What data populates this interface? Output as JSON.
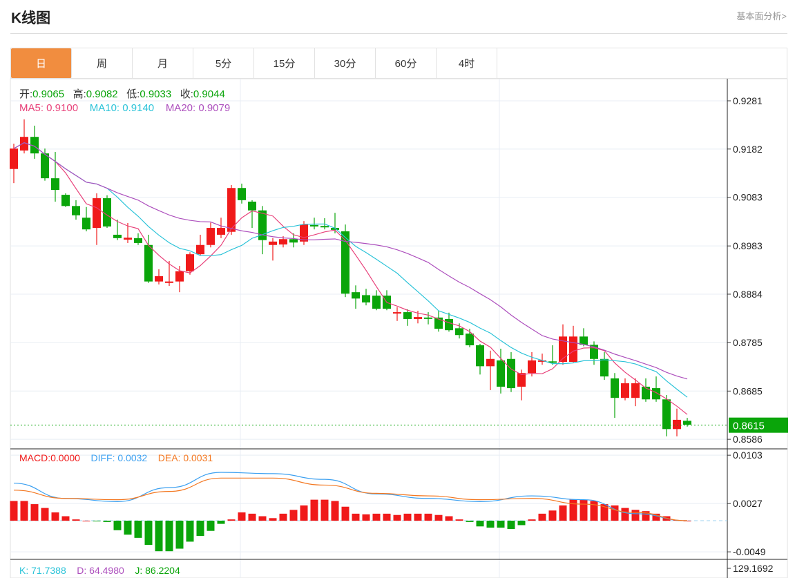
{
  "header": {
    "title": "K线图",
    "more_link": "基本面分析>"
  },
  "tabs": [
    "日",
    "周",
    "月",
    "5分",
    "15分",
    "30分",
    "60分",
    "4时"
  ],
  "active_tab": 0,
  "ohlc_info": {
    "open_label": "开:",
    "open": "0.9065",
    "high_label": "高:",
    "high": "0.9082",
    "low_label": "低:",
    "low": "0.9033",
    "close_label": "收:",
    "close": "0.9044"
  },
  "ma_info": {
    "ma5": "MA5: 0.9100",
    "ma10": "MA10: 0.9140",
    "ma20": "MA20: 0.9079"
  },
  "macd_info": {
    "macd": "MACD:0.0000",
    "diff": "DIFF: 0.0032",
    "dea": "DEA: 0.0031"
  },
  "kdj_info": {
    "k": "K: 71.7388",
    "d": "D: 64.4980",
    "j": "J: 86.2204"
  },
  "colors": {
    "up": "#f01a1a",
    "down": "#0aa50a",
    "ma5": "#e8417a",
    "ma10": "#2bc3d8",
    "ma20": "#ad4fbd",
    "diff": "#3ca0f0",
    "dea": "#f37720",
    "accent": "#f18d3f"
  },
  "chart_data": {
    "type": "candlestick",
    "price_ticks": [
      "0.9281",
      "0.9182",
      "0.9083",
      "0.8983",
      "0.8884",
      "0.8785",
      "0.8685",
      "0.8586"
    ],
    "current_price": "0.8615",
    "macd_ticks": [
      "0.0103",
      "0.0027",
      "-0.0049"
    ],
    "kdj_tick": "129.1692",
    "ylim": [
      0.8586,
      0.9281
    ],
    "candles": [
      [
        0.9141,
        0.9183,
        0.9193,
        0.9112
      ],
      [
        0.9179,
        0.9207,
        0.9243,
        0.9173
      ],
      [
        0.9207,
        0.9173,
        0.923,
        0.9162
      ],
      [
        0.9173,
        0.9122,
        0.9183,
        0.9117
      ],
      [
        0.9122,
        0.9098,
        0.9176,
        0.9074
      ],
      [
        0.9088,
        0.9065,
        0.9091,
        0.9063
      ],
      [
        0.9065,
        0.9046,
        0.9077,
        0.9037
      ],
      [
        0.9041,
        0.9017,
        0.9063,
        0.9013
      ],
      [
        0.902,
        0.9081,
        0.9091,
        0.8985
      ],
      [
        0.9081,
        0.9023,
        0.9087,
        0.902
      ],
      [
        0.9006,
        0.8999,
        0.9037,
        0.8995
      ],
      [
        0.8996,
        0.9,
        0.903,
        0.8989
      ],
      [
        0.8999,
        0.8989,
        0.9009,
        0.8985
      ],
      [
        0.8985,
        0.891,
        0.9006,
        0.8907
      ],
      [
        0.891,
        0.8921,
        0.8935,
        0.8904
      ],
      [
        0.8907,
        0.891,
        0.8952,
        0.8901
      ],
      [
        0.891,
        0.8931,
        0.8942,
        0.8888
      ],
      [
        0.8931,
        0.8966,
        0.897,
        0.8924
      ],
      [
        0.8966,
        0.8985,
        0.9006,
        0.8963
      ],
      [
        0.8985,
        0.902,
        0.9031,
        0.898
      ],
      [
        0.9006,
        0.902,
        0.9041,
        0.8999
      ],
      [
        0.9012,
        0.9102,
        0.9108,
        0.9006
      ],
      [
        0.9102,
        0.9077,
        0.9111,
        0.907
      ],
      [
        0.9074,
        0.9056,
        0.9077,
        0.902
      ],
      [
        0.9056,
        0.8995,
        0.9065,
        0.8966
      ],
      [
        0.8985,
        0.8992,
        0.8999,
        0.8953
      ],
      [
        0.8986,
        0.8997,
        0.9003,
        0.898
      ],
      [
        0.8997,
        0.899,
        0.9009,
        0.898
      ],
      [
        0.8992,
        0.9027,
        0.9034,
        0.8985
      ],
      [
        0.9026,
        0.9023,
        0.9041,
        0.9017
      ],
      [
        0.9024,
        0.9022,
        0.904,
        0.9017
      ],
      [
        0.902,
        0.9016,
        0.9051,
        0.9009
      ],
      [
        0.9013,
        0.8885,
        0.9027,
        0.8878
      ],
      [
        0.8888,
        0.8875,
        0.8902,
        0.8854
      ],
      [
        0.8882,
        0.8867,
        0.8895,
        0.8861
      ],
      [
        0.8881,
        0.8854,
        0.8892,
        0.8851
      ],
      [
        0.8881,
        0.8854,
        0.8892,
        0.8851
      ],
      [
        0.8846,
        0.8847,
        0.8857,
        0.8829
      ],
      [
        0.8847,
        0.8833,
        0.8853,
        0.8819
      ],
      [
        0.8833,
        0.8837,
        0.885,
        0.8824
      ],
      [
        0.8836,
        0.8834,
        0.8847,
        0.8822
      ],
      [
        0.8836,
        0.8813,
        0.885,
        0.8807
      ],
      [
        0.8833,
        0.881,
        0.8846,
        0.8807
      ],
      [
        0.8814,
        0.88,
        0.8824,
        0.8793
      ],
      [
        0.8803,
        0.8779,
        0.8813,
        0.8775
      ],
      [
        0.8779,
        0.8736,
        0.8782,
        0.8719
      ],
      [
        0.8736,
        0.8751,
        0.8768,
        0.8687
      ],
      [
        0.8748,
        0.8694,
        0.8772,
        0.868
      ],
      [
        0.8751,
        0.8691,
        0.8765,
        0.8683
      ],
      [
        0.8694,
        0.8722,
        0.8729,
        0.8666
      ],
      [
        0.8722,
        0.8748,
        0.8765,
        0.8715
      ],
      [
        0.8746,
        0.8748,
        0.8762,
        0.8739
      ],
      [
        0.8746,
        0.8745,
        0.8779,
        0.8739
      ],
      [
        0.8745,
        0.8797,
        0.8822,
        0.8739
      ],
      [
        0.8745,
        0.8797,
        0.8819,
        0.8744
      ],
      [
        0.8797,
        0.878,
        0.8814,
        0.8777
      ],
      [
        0.878,
        0.8751,
        0.8787,
        0.8739
      ],
      [
        0.8751,
        0.8715,
        0.8765,
        0.8708
      ],
      [
        0.8711,
        0.8671,
        0.8722,
        0.863
      ],
      [
        0.8671,
        0.8701,
        0.8711,
        0.8666
      ],
      [
        0.8671,
        0.8701,
        0.8711,
        0.8654
      ],
      [
        0.8694,
        0.8668,
        0.8711,
        0.8663
      ],
      [
        0.8691,
        0.8668,
        0.8715,
        0.8663
      ],
      [
        0.8668,
        0.8607,
        0.8677,
        0.8592
      ],
      [
        0.8607,
        0.8626,
        0.8649,
        0.8592
      ],
      [
        0.8624,
        0.8616,
        0.863,
        0.8612
      ]
    ],
    "macd_hist": [
      0.0031,
      0.0031,
      0.0026,
      0.002,
      0.0013,
      0.0007,
      0.0002,
      0,
      -0.0001,
      -0.0002,
      -0.0015,
      -0.0022,
      -0.0027,
      -0.0038,
      -0.0048,
      -0.0048,
      -0.0044,
      -0.0033,
      -0.0024,
      -0.0016,
      -0.0005,
      0.0002,
      0.0013,
      0.0011,
      0.0007,
      0.0004,
      0.0011,
      0.0017,
      0.0024,
      0.0033,
      0.0033,
      0.0031,
      0.0022,
      0.0011,
      0.001,
      0.0011,
      0.0011,
      0.0009,
      0.0011,
      0.0011,
      0.0011,
      0.0009,
      0.0007,
      0.0002,
      -0.0002,
      -0.0009,
      -0.0011,
      -0.0011,
      -0.0013,
      -0.0007,
      0.0002,
      0.0011,
      0.0016,
      0.0024,
      0.0033,
      0.0033,
      0.0031,
      0.0026,
      0.0024,
      0.002,
      0.0017,
      0.0015,
      0.0011,
      0.0007,
      0.0001,
      0
    ],
    "diff_samples": [
      0.0059,
      0.0035,
      0.003,
      0.0052,
      0.0076,
      0.0074,
      0.0065,
      0.0042,
      0.0035,
      0.003,
      0.0039,
      0.0033,
      0.0011,
      0.0
    ],
    "dea_samples": [
      0.0048,
      0.0035,
      0.0033,
      0.0046,
      0.0067,
      0.0067,
      0.0056,
      0.0043,
      0.0039,
      0.0033,
      0.0035,
      0.0026,
      0.0013,
      0.0
    ],
    "sample_step": 5
  }
}
